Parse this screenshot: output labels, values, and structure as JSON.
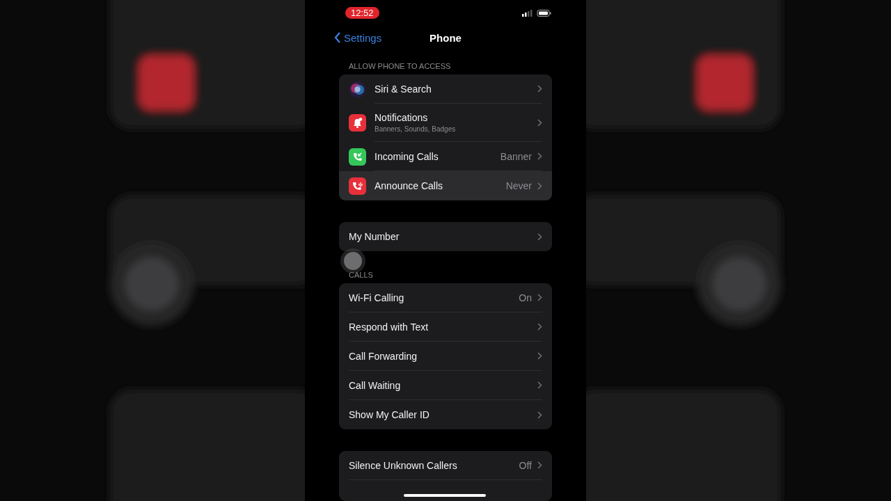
{
  "status_bar": {
    "time": "12:52",
    "recording": true
  },
  "nav": {
    "back": "Settings",
    "title": "Phone"
  },
  "groups": [
    {
      "header": "ALLOW PHONE TO ACCESS",
      "rows": [
        {
          "label": "Siri & Search",
          "kind": "siri",
          "selected": false
        },
        {
          "label": "Notifications",
          "subtitle": "Banners, Sounds, Badges",
          "kind": "bell",
          "selected": false
        },
        {
          "label": "Incoming Calls",
          "value": "Banner",
          "kind": "phone-in",
          "selected": false
        },
        {
          "label": "Announce Calls",
          "value": "Never",
          "kind": "phone-announce",
          "selected": true
        }
      ]
    },
    {
      "rows": [
        {
          "label": "My Number",
          "selected": false
        }
      ]
    },
    {
      "header": "CALLS",
      "rows": [
        {
          "label": "Wi-Fi Calling",
          "value": "On",
          "selected": false
        },
        {
          "label": "Respond with Text",
          "selected": false
        },
        {
          "label": "Call Forwarding",
          "selected": false
        },
        {
          "label": "Call Waiting",
          "selected": false
        },
        {
          "label": "Show My Caller ID",
          "selected": false
        }
      ]
    },
    {
      "rows": [
        {
          "label": "Silence Unknown Callers",
          "value": "Off",
          "selected": false
        }
      ]
    }
  ]
}
